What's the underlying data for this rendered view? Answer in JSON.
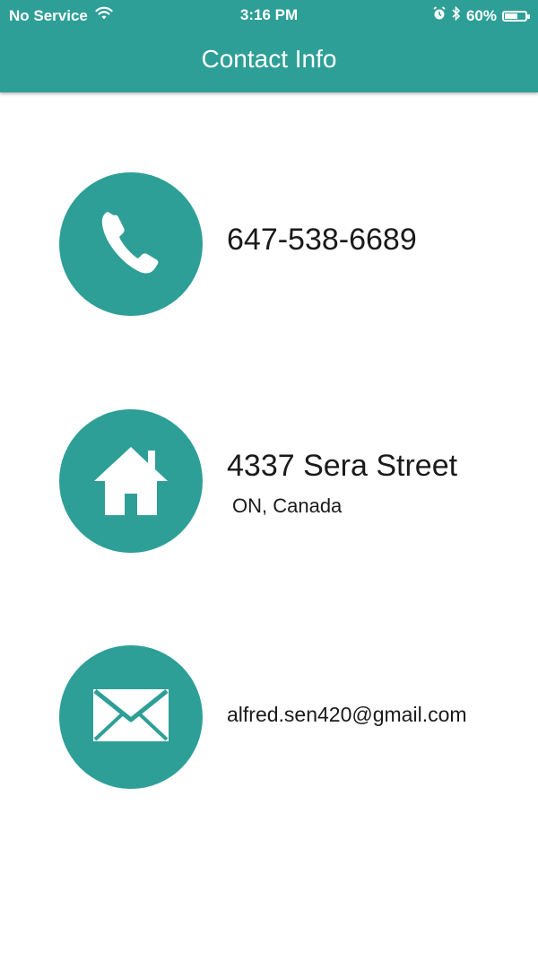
{
  "status_bar": {
    "carrier": "No Service",
    "time": "3:16 PM",
    "battery": "60%"
  },
  "header": {
    "title": "Contact Info"
  },
  "contacts": {
    "phone": "647-538-6689",
    "address_line1": "4337 Sera Street",
    "address_line2": "ON, Canada",
    "email": "alfred.sen420@gmail.com"
  },
  "colors": {
    "accent": "#2e9f97"
  },
  "icons": [
    "wifi-icon",
    "alarm-icon",
    "bluetooth-icon",
    "battery-icon",
    "phone-icon",
    "home-icon",
    "mail-icon"
  ]
}
